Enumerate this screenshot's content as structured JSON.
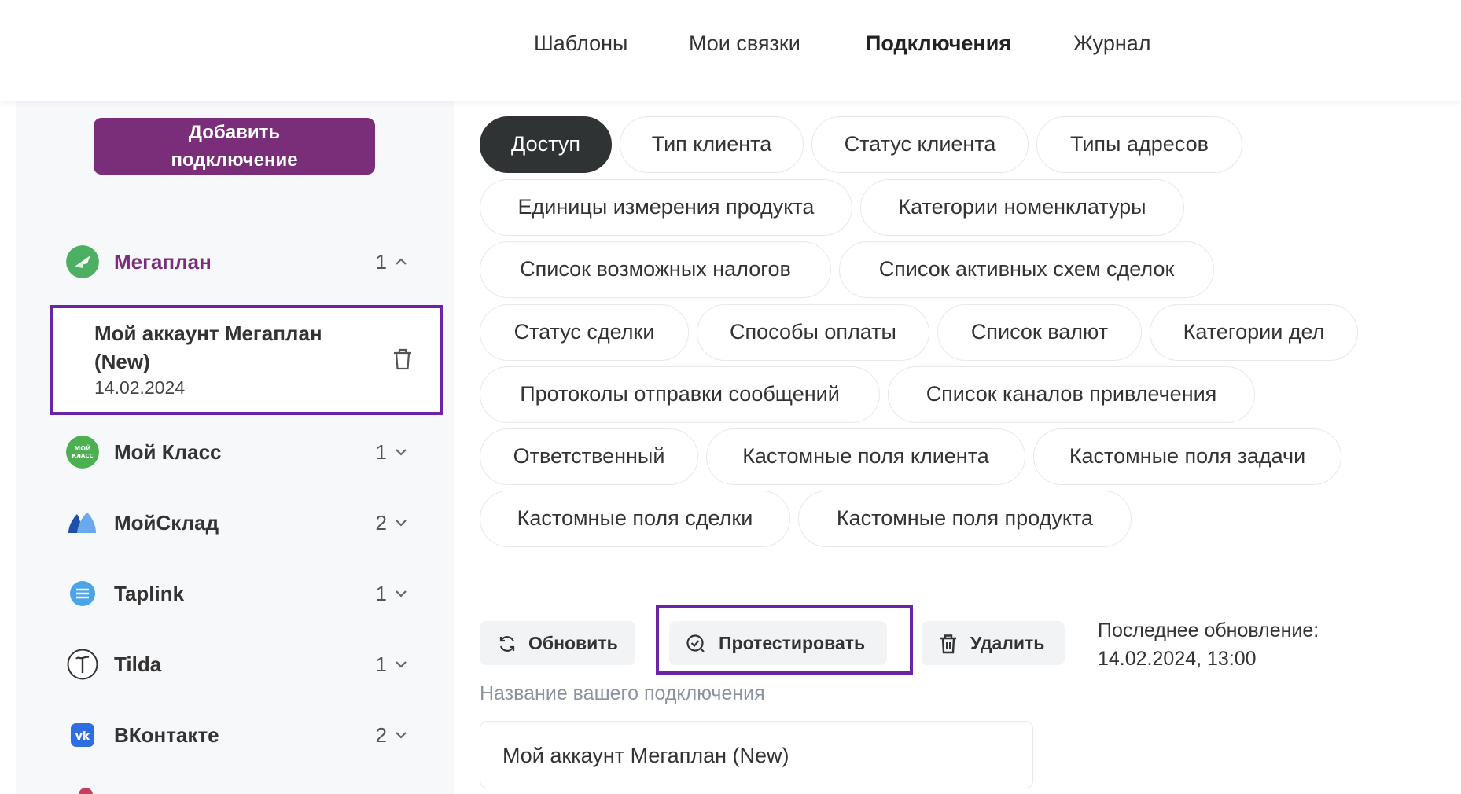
{
  "nav": {
    "items": [
      "Шаблоны",
      "Мои связки",
      "Подключения",
      "Журнал"
    ],
    "active": "Подключения"
  },
  "sidebar": {
    "add_button_line1": "Добавить",
    "add_button_line2": "подключение",
    "services": [
      {
        "name": "Мегаплан",
        "count": "1",
        "expanded": true,
        "logo": "megaplan-logo"
      },
      {
        "name": "Мой Класс",
        "count": "1",
        "expanded": false,
        "logo": "moyklass-logo"
      },
      {
        "name": "МойСклад",
        "count": "2",
        "expanded": false,
        "logo": "moysklad-logo"
      },
      {
        "name": "Taplink",
        "count": "1",
        "expanded": false,
        "logo": "taplink-logo"
      },
      {
        "name": "Tilda",
        "count": "1",
        "expanded": false,
        "logo": "tilda-logo"
      },
      {
        "name": "ВКонтакте",
        "count": "2",
        "expanded": false,
        "logo": "vk-logo"
      }
    ],
    "account": {
      "name": "Мой аккаунт Мегаплан (New)",
      "date": "14.02.2024"
    }
  },
  "chips": [
    "Доступ",
    "Тип клиента",
    "Статус клиента",
    "Типы адресов",
    "Единицы измерения продукта",
    "Категории номенклатуры",
    "Список возможных налогов",
    "Список активных схем сделок",
    "Статус сделки",
    "Способы оплаты",
    "Список валют",
    "Категории дел",
    "Протоколы отправки сообщений",
    "Список каналов привлечения",
    "Ответственный",
    "Кастомные поля клиента",
    "Кастомные поля задачи",
    "Кастомные поля сделки",
    "Кастомные поля продукта"
  ],
  "active_chip": "Доступ",
  "actions": {
    "refresh": "Обновить",
    "test": "Протестировать",
    "delete": "Удалить"
  },
  "last_update": {
    "label": "Последнее обновление:",
    "value": "14.02.2024, 13:00"
  },
  "connection_name": {
    "label": "Название вашего подключения",
    "value": "Мой аккаунт Мегаплан (New)"
  },
  "colors": {
    "brand": "#7a2d78",
    "highlight": "#6b24a6",
    "active_chip": "#2f3334"
  }
}
